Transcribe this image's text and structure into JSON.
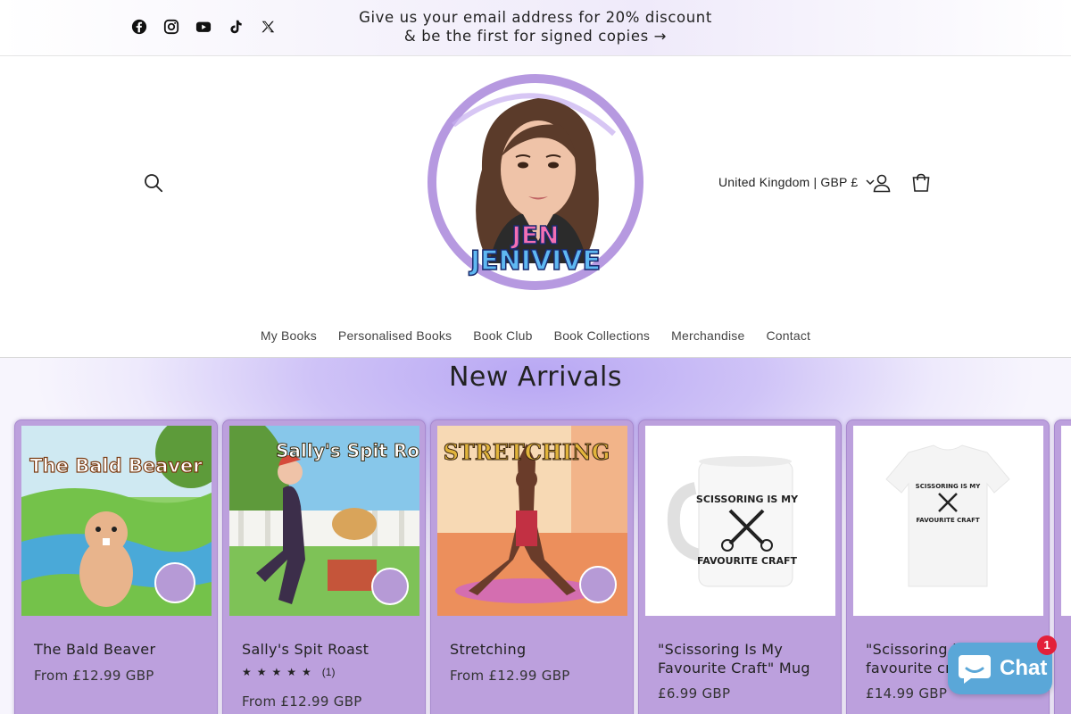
{
  "announcement": {
    "text": "Give us your email address for 20% discount & be the first for signed copies →"
  },
  "socials": [
    "facebook-icon",
    "instagram-icon",
    "youtube-icon",
    "tiktok-icon",
    "x-icon"
  ],
  "header": {
    "logo_text_line1": "JEN",
    "logo_text_line2": "JENIVIVE",
    "locale": "United Kingdom | GBP £"
  },
  "nav": {
    "items": [
      "My Books",
      "Personalised Books",
      "Book Club",
      "Book Collections",
      "Merchandise",
      "Contact"
    ]
  },
  "section": {
    "title": "New Arrivals"
  },
  "products": [
    {
      "title": "The Bald Beaver",
      "price": "From £12.99 GBP",
      "image_text": "The Bald Beaver"
    },
    {
      "title": "Sally's Spit Roast",
      "price": "From £12.99 GBP",
      "rating_stars": "★★★★★",
      "rating_count": "(1)",
      "image_text": "Sally's Spit Roast"
    },
    {
      "title": "Stretching",
      "price": "From £12.99 GBP",
      "image_text": "STRETCHING"
    },
    {
      "title": "\"Scissoring Is My Favourite Craft\" Mug",
      "price": "£6.99 GBP",
      "image_text_1": "SCISSORING IS MY",
      "image_text_2": "FAVOURITE CRAFT"
    },
    {
      "title": "\"Scissoring is my favourite craft\"",
      "price": "£14.99 GBP",
      "image_text_1": "SCISSORING IS MY",
      "image_text_2": "FAVOURITE CRAFT"
    }
  ],
  "chat": {
    "label": "Chat",
    "badge": "1"
  },
  "colors": {
    "card_bg": "#bca0dd",
    "accent_purple": "#b8a7f3",
    "chat_blue": "#5aa7d8"
  }
}
